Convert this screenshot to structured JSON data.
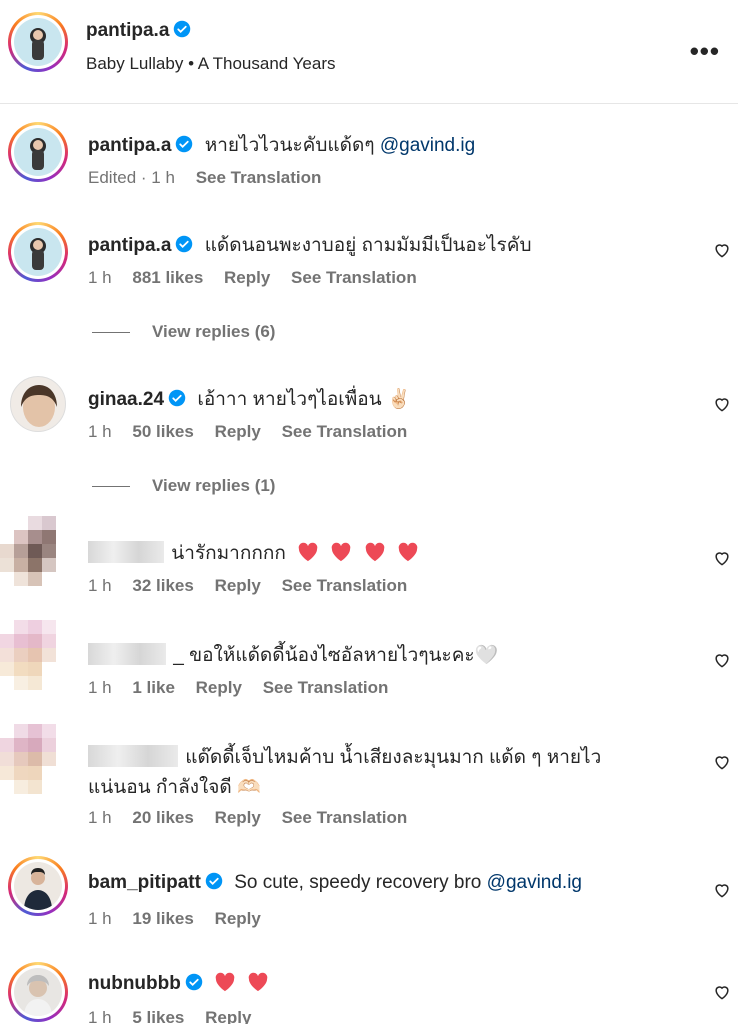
{
  "post": {
    "username": "pantipa.a",
    "audio": "Baby Lullaby • A Thousand Years"
  },
  "caption": {
    "username": "pantipa.a",
    "text": "หายไวไวนะคับแด้ดๆ",
    "mention": "@gavind.ig",
    "edited": "Edited · 1 h",
    "see_translation": "See Translation"
  },
  "comments": [
    {
      "username": "pantipa.a",
      "text": "แด้ดนอนพะงาบอยู่ ถามมัมมีเป็นอะไรคับ",
      "time": "1 h",
      "likes": "881 likes",
      "reply": "Reply",
      "see_translation": "See Translation",
      "view_replies": "View replies (6)"
    },
    {
      "username": "ginaa.24",
      "text": "เอ้าาา หายไวๆไอเพื่อน ✌🏻",
      "time": "1 h",
      "likes": "50 likes",
      "reply": "Reply",
      "see_translation": "See Translation",
      "view_replies": "View replies (1)"
    },
    {
      "text": "น่ารักมากกกก",
      "time": "1 h",
      "likes": "32 likes",
      "reply": "Reply",
      "see_translation": "See Translation"
    },
    {
      "text": "_ ขอให้แด้ดดี้น้องไซอัลหายไวๆนะคะ🤍",
      "time": "1 h",
      "likes": "1 like",
      "reply": "Reply",
      "see_translation": "See Translation"
    },
    {
      "text": "แด๊ดดี้เจ็บไหมค้าบ น้ำเสียงละมุนมาก แด้ด ๆ หายไว",
      "text2": "แน่นอน กำลังใจดี 🫶🏻",
      "time": "1 h",
      "likes": "20 likes",
      "reply": "Reply",
      "see_translation": "See Translation"
    },
    {
      "username": "bam_pitipatt",
      "text": "So cute, speedy recovery bro",
      "mention": "@gavind.ig",
      "time": "1 h",
      "likes": "19 likes",
      "reply": "Reply"
    },
    {
      "username": "nubnubbb",
      "time": "1 h",
      "likes": "5 likes",
      "reply": "Reply"
    }
  ],
  "colors": {
    "verified": "#0095f6",
    "mention": "#00376b",
    "heart_red": "#ed4956",
    "meta_gray": "#737373"
  },
  "icons": [
    "verified-badge-icon",
    "more-options-icon",
    "heart-outline-icon",
    "red-heart-icon"
  ]
}
